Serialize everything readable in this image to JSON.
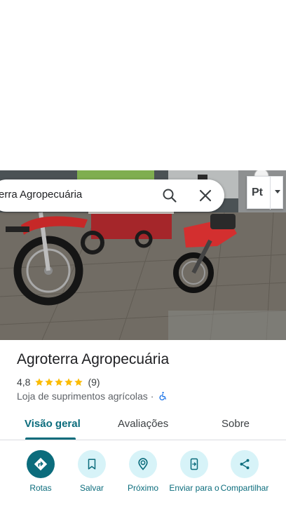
{
  "search": {
    "query": "erra Agropecuária"
  },
  "language_control": {
    "label": "Pt"
  },
  "place": {
    "name": "Agroterra Agropecuária",
    "rating": "4,8",
    "stars": 5,
    "review_count": "(9)",
    "category": "Loja de suprimentos agrícolas",
    "separator": "·"
  },
  "tabs": [
    {
      "label": "Visão geral",
      "active": true
    },
    {
      "label": "Avaliações",
      "active": false
    },
    {
      "label": "Sobre",
      "active": false
    }
  ],
  "actions": [
    {
      "label": "Rotas",
      "icon": "directions-icon"
    },
    {
      "label": "Salvar",
      "icon": "bookmark-icon"
    },
    {
      "label": "Próximo",
      "icon": "nearby-icon"
    },
    {
      "label": "Enviar para o",
      "icon": "send-to-phone-icon"
    },
    {
      "label": "Compartilhar",
      "icon": "share-icon"
    }
  ],
  "colors": {
    "accent": "#0b6c7c",
    "accent_light": "#d7f3f8",
    "star": "#fbbc04",
    "accessibility": "#1a73e8"
  }
}
